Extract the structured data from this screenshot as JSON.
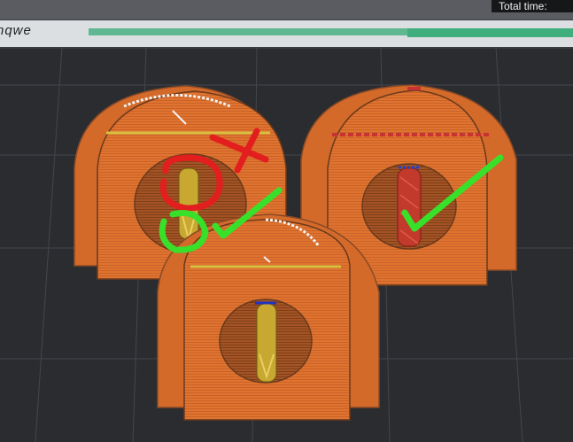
{
  "header": {
    "total_time_label": "Total time:"
  },
  "timeline": {
    "label": "nqwe",
    "track_color": "#5fb891"
  },
  "viewport": {
    "background_color": "#2b2c30",
    "object_color": "#e0742f",
    "infill_color": "#c8a830",
    "annotations": {
      "bad_mark": "red X and circle",
      "good_mark": "green check and circle"
    }
  }
}
